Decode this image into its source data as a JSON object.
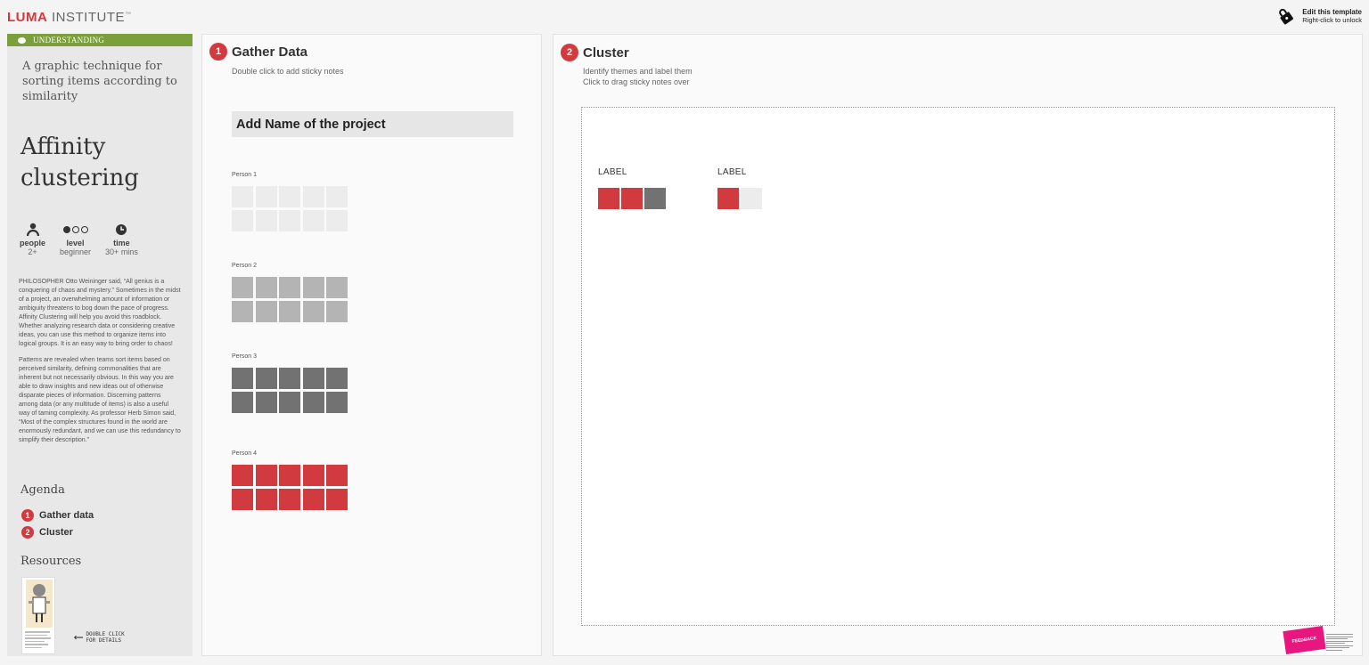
{
  "brand": {
    "name_red": "LUMA",
    "name_rest": "INSTITUTE",
    "tm": "™"
  },
  "edit_template": {
    "title": "Edit this template",
    "subtitle": "Right-click to unlock",
    "icon": "lock-icon"
  },
  "sidebar": {
    "category": "UNDERSTANDING",
    "tagline": "A graphic technique for sorting items according to similarity",
    "title_line1": "Affinity",
    "title_line2": "clustering",
    "stats": [
      {
        "icon": "person-icon",
        "label": "people",
        "value": "2+"
      },
      {
        "icon": "level-dots-icon",
        "label": "level",
        "value": "beginner"
      },
      {
        "icon": "clock-icon",
        "label": "time",
        "value": "30+ mins"
      }
    ],
    "description": [
      "PHILOSOPHER Otto Weininger said, “All genius is a conquering of chaos and mystery.” Sometimes in the midst of a project, an overwhelming amount of information or ambiguity threatens to bog down the pace of progress. Affinity Clustering will help you avoid this roadblock. Whether analyzing research data or considering creative ideas, you can use this method to organize items into logical groups. It is an easy way to bring order to chaos!",
      "Patterns are revealed when teams sort items based on perceived similarity, defining commonalities that are inherent but not necessarily obvious. In this way you are able to draw insights and new ideas out of otherwise disparate pieces of information. Discerning patterns among data (or any multitude of items) is also a useful way of taming complexity. As professor Herb Simon said, “Most of the complex structures found in the world are enormously redundant, and we can use this redundancy to simplify their description.”"
    ],
    "agenda_heading": "Agenda",
    "agenda": [
      {
        "num": "1",
        "label": "Gather data"
      },
      {
        "num": "2",
        "label": "Cluster"
      }
    ],
    "resources_heading": "Resources",
    "resource_hint_line1": "DOUBLE CLICK",
    "resource_hint_line2": "FOR DETAILS"
  },
  "gather": {
    "num": "1",
    "title": "Gather Data",
    "subtitle": "Double click to add sticky notes",
    "project_name": "Add Name of the project",
    "persons": [
      {
        "label": "Person 1",
        "color": "#ececec"
      },
      {
        "label": "Person 2",
        "color": "#b4b4b4"
      },
      {
        "label": "Person 3",
        "color": "#727272"
      },
      {
        "label": "Person 4",
        "color": "#d13a3e"
      }
    ]
  },
  "cluster": {
    "num": "2",
    "title": "Cluster",
    "subtitle_line1": "Identify themes and label them",
    "subtitle_line2": "Click to drag sticky notes over",
    "groups": [
      {
        "label": "LABEL",
        "notes": [
          "#d13a3e",
          "#d13a3e",
          "#727272"
        ]
      },
      {
        "label": "LABEL",
        "notes": [
          "#d13a3e",
          "#ececec"
        ]
      }
    ],
    "feedback_badge": "FEEDBACK"
  }
}
